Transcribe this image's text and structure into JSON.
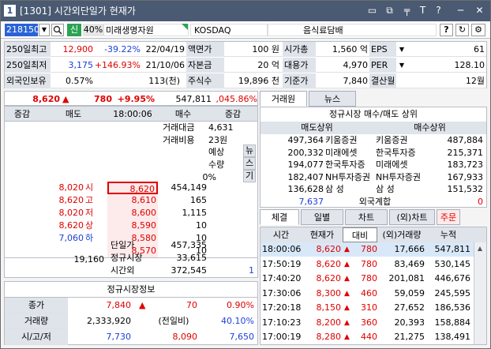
{
  "window": {
    "title": "[1301] 시간외단일가 현재가",
    "logo": "1",
    "icons": [
      "window-icon",
      "copy-icon",
      "pin-icon",
      "text-icon",
      "help-icon",
      "minimize-icon",
      "close-icon"
    ],
    "icon_glyphs": [
      "▭",
      "⧉",
      "╤",
      "T",
      "?",
      "─",
      "✕"
    ]
  },
  "toolbar": {
    "code": "218150",
    "badge1": "신",
    "badge2": "40%",
    "name": "미래생명자원",
    "date": "22/04/19",
    "market": "KOSDAQ",
    "sector": "음식료담배",
    "buttons": [
      "?",
      "↻",
      "⚙"
    ]
  },
  "info": [
    {
      "l1": "250일최고",
      "v1": "12,900",
      "v2": "-39.22%",
      "d": "22/04/19",
      "l2": "액면가",
      "v3": "100 원",
      "l3": "시가총",
      "v4": "1,560 억",
      "l4": "EPS",
      "v5": "61"
    },
    {
      "l1": "250일최저",
      "v1": "3,175",
      "v2": "+146.93%",
      "d": "21/10/06",
      "l2": "자본금",
      "v3": "20 억",
      "l3": "대용가",
      "v4": "4,970",
      "l4": "PER",
      "v5": "128.10"
    },
    {
      "l1": "외국인보유",
      "v1": "0.57%",
      "v2": "113(천)",
      "d": "",
      "l2": "주식수",
      "v3": "19,896 천",
      "l3": "기준가",
      "v4": "7,840",
      "l4": "결산월",
      "v5": "12월"
    }
  ],
  "price": {
    "current": "8,620",
    "arrow": "▲",
    "change": "780",
    "rate": "+9.95%",
    "volume": "547,811",
    "vol_rate": ",045.86%"
  },
  "orderbook": {
    "headers": [
      "증감",
      "매도",
      "18:00:06",
      "매수",
      "증감"
    ],
    "summary": [
      {
        "label": "거래대금",
        "value": "4,631"
      },
      {
        "label": "거래비용",
        "value": "23원"
      }
    ],
    "expect": {
      "line1": "예상",
      "line2": "수량",
      "line3": "0%",
      "side": [
        "뉴",
        "스",
        "기"
      ]
    },
    "ask_prices": [
      "8,620",
      "8,610",
      "8,600",
      "8,590",
      "8,580",
      "8,570"
    ],
    "ask_qty": [
      "454,149",
      "165",
      "1,115",
      "10",
      "10",
      "10"
    ],
    "left_labels": [
      {
        "p": "8,020",
        "t": "시"
      },
      {
        "p": "8,620",
        "t": "고"
      },
      {
        "p": "8,020",
        "t": "저"
      },
      {
        "p": "8,620",
        "t": "상"
      },
      {
        "p": "7,060",
        "t": "하"
      }
    ],
    "bottom": {
      "left_total": "19,160",
      "rows": [
        {
          "l": "단일가",
          "v": "457,335"
        },
        {
          "l": "정규시장",
          "v": "33,615"
        },
        {
          "l": "시간외",
          "v": "372,545",
          "x": "1"
        }
      ]
    }
  },
  "regular": {
    "title": "정규시장정보",
    "rows": [
      {
        "l": "종가",
        "a": "7,840",
        "b": "70",
        "c": "0.90%"
      },
      {
        "l": "거래량",
        "a": "2,333,920",
        "b": "(전일비)",
        "c": "40.10%"
      },
      {
        "l": "시/고/저",
        "a": "7,730",
        "b": "8,090",
        "c": "7,650"
      }
    ]
  },
  "broker": {
    "tabs": [
      "거래원",
      "뉴스"
    ],
    "title": "정규시장 매수/매도 상위",
    "sell_hd": "매도상위",
    "buy_hd": "매수상위",
    "rows": [
      {
        "sq": "497,364",
        "sn": "키움증권",
        "bn": "키움증권",
        "bq": "487,884"
      },
      {
        "sq": "200,332",
        "sn": "미래에셋",
        "bn": "한국투자증",
        "bq": "215,371"
      },
      {
        "sq": "194,077",
        "sn": "한국투자증",
        "bn": "미래에셋",
        "bq": "183,723"
      },
      {
        "sq": "182,407",
        "sn": "NH투자증권",
        "bn": "NH투자증권",
        "bq": "167,933"
      },
      {
        "sq": "136,628",
        "sn": "삼 성",
        "bn": "삼 성",
        "bq": "151,532"
      }
    ],
    "foreign": {
      "left": "7,637",
      "label": "외국계합",
      "right": "0"
    }
  },
  "trades": {
    "tabs": [
      "체결",
      "일별",
      "차트",
      "(외)차트",
      "주문"
    ],
    "headers": [
      "시간",
      "현재가",
      "대비",
      "(외)거래량",
      "누적"
    ],
    "rows": [
      {
        "t": "18:00:06",
        "p": "8,620",
        "d": "780",
        "v": "17,666",
        "c": "547,811"
      },
      {
        "t": "17:50:19",
        "p": "8,620",
        "d": "780",
        "v": "83,469",
        "c": "530,145"
      },
      {
        "t": "17:40:20",
        "p": "8,620",
        "d": "780",
        "v": "201,081",
        "c": "446,676"
      },
      {
        "t": "17:30:06",
        "p": "8,300",
        "d": "460",
        "v": "59,059",
        "c": "245,595"
      },
      {
        "t": "17:20:18",
        "p": "8,150",
        "d": "310",
        "v": "27,652",
        "c": "186,536"
      },
      {
        "t": "17:10:23",
        "p": "8,200",
        "d": "360",
        "v": "20,393",
        "c": "158,884"
      },
      {
        "t": "17:00:19",
        "p": "8,280",
        "d": "440",
        "v": "21,275",
        "c": "138,491"
      }
    ]
  },
  "colors": {
    "up": "#e00000",
    "down": "#1c3fd8",
    "header": "#dfe3ea",
    "title": "#4a5a72"
  }
}
